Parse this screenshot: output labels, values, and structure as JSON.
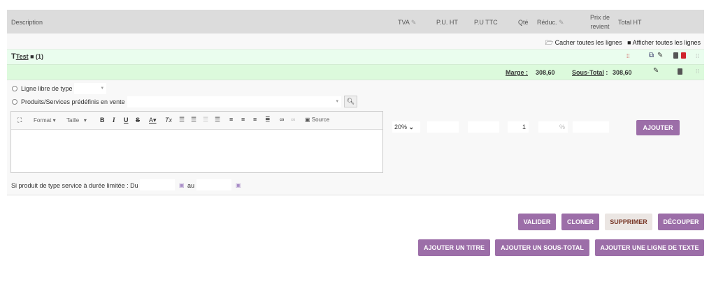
{
  "header": {
    "description": "Description",
    "tva": "TVA",
    "pu_ht": "P.U. HT",
    "pu_ttc": "P.U TTC",
    "qty": "Qté",
    "reduc": "Réduc.",
    "prix_revient_1": "Prix de",
    "prix_revient_2": "revient",
    "total_ht": "Total HT"
  },
  "toggles": {
    "hide_all": "Cacher toutes les lignes",
    "show_all": "Afficher toutes les lignes"
  },
  "title_row": {
    "label": "Test",
    "count": "(1)"
  },
  "subtotal_row": {
    "marge_label": "Marge :",
    "marge_value": "308,60",
    "subtotal_label": "Sous-Total",
    "subtotal_colon": ":",
    "subtotal_value": "308,60"
  },
  "form": {
    "free_line_label": "Ligne libre de type",
    "predefined_label": "Produits/Services prédéfinis en vente",
    "editor_toolbar": {
      "format": "Format",
      "size": "Taille",
      "source": "Source"
    },
    "service_label": "Si produit de type service à durée limitée : Du",
    "au_label": "au",
    "tva_value": "20%",
    "qty_value": "1",
    "percent": "%",
    "add_button": "AJOUTER"
  },
  "actions": {
    "validate": "VALIDER",
    "clone": "CLONER",
    "delete": "SUPPRIMER",
    "split": "DÉCOUPER",
    "add_title": "AJOUTER UN TITRE",
    "add_subtotal": "AJOUTER UN SOUS-TOTAL",
    "add_text_line": "AJOUTER UNE LIGNE DE TEXTE"
  },
  "colors": {
    "accent": "#9c6ea8",
    "header_bg": "#dcdcdc",
    "title_row_bg": "#eafdee",
    "subtotal_row_bg": "#dcfadc"
  }
}
